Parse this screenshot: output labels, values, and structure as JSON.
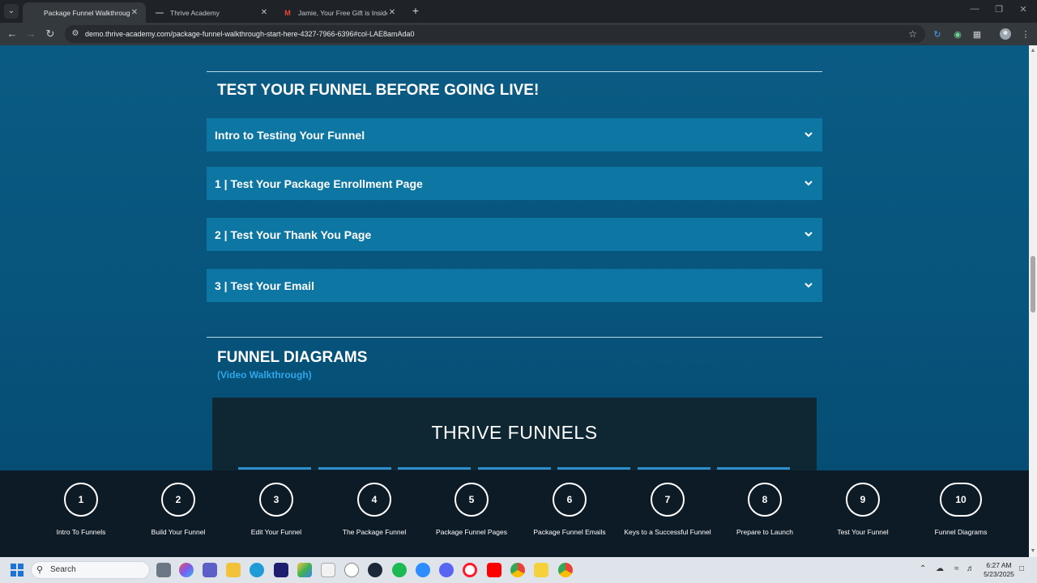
{
  "browser": {
    "tabs": [
      {
        "title": "Package Funnel Walkthrough (",
        "active": true
      },
      {
        "title": "Thrive Academy",
        "active": false
      },
      {
        "title": "Jamie, Your Free Gift is Inside!",
        "active": false
      }
    ],
    "url": "demo.thrive-academy.com/package-funnel-walkthrough-start-here-4327-7966-6396#col-LAE8amAda0"
  },
  "testing_section": {
    "title": "TEST YOUR FUNNEL BEFORE GOING LIVE!",
    "items": [
      {
        "label": "Intro to Testing Your Funnel"
      },
      {
        "label": "1 | Test Your Package Enrollment Page"
      },
      {
        "label": "2 | Test Your Thank You Page"
      },
      {
        "label": "3 | Test Your Email"
      }
    ]
  },
  "diagrams_section": {
    "title": "FUNNEL DIAGRAMS",
    "subtitle": "(Video Walkthrough)",
    "video_title": "THRIVE FUNNELS"
  },
  "steps": [
    {
      "number": "1",
      "label": "Intro To Funnels"
    },
    {
      "number": "2",
      "label": "Build Your Funnel"
    },
    {
      "number": "3",
      "label": "Edit Your Funnel"
    },
    {
      "number": "4",
      "label": "The Package Funnel"
    },
    {
      "number": "5",
      "label": "Package Funnel Pages"
    },
    {
      "number": "6",
      "label": "Package Funnel Emails"
    },
    {
      "number": "7",
      "label": "Keys to a Successful Funnel"
    },
    {
      "number": "8",
      "label": "Prepare to Launch"
    },
    {
      "number": "9",
      "label": "Test Your Funnel"
    },
    {
      "number": "10",
      "label": "Funnel Diagrams"
    }
  ],
  "taskbar": {
    "search_label": "Search",
    "time": "6:27 AM",
    "date": "5/23/2025"
  },
  "colors": {
    "page_bg": "#0a5b84",
    "accordion_bg": "#0e76a3",
    "accent_link": "#2ea6e8",
    "step_bar_bg": "#0d1b26"
  }
}
